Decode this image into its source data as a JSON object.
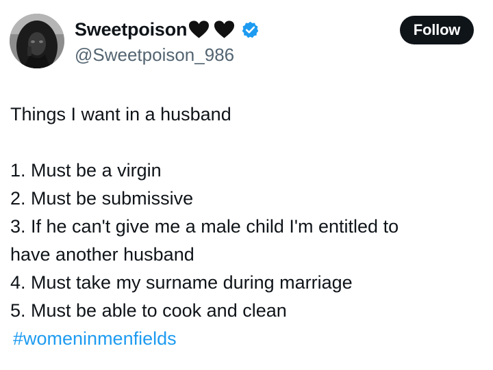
{
  "author": {
    "display_name": "Sweetpoison",
    "name_emojis": [
      "black-heart-icon",
      "black-heart-icon"
    ],
    "handle": "@Sweetpoison_986",
    "verified": true,
    "verified_color": "#1d9bf0"
  },
  "follow_button": {
    "label": "Follow",
    "background": "#0f1419",
    "text_color": "#ffffff"
  },
  "tweet": {
    "intro": "Things I want in a husband",
    "items": [
      "1. Must be a virgin",
      "2. Must be submissive",
      "3. If he can't give me a male child I'm entitled to",
      "have another husband",
      "4. Must take my surname during marriage",
      "5. Must be able to cook and clean"
    ],
    "hashtag": "#womeninmenfields",
    "hashtag_color": "#1d9bf0"
  }
}
